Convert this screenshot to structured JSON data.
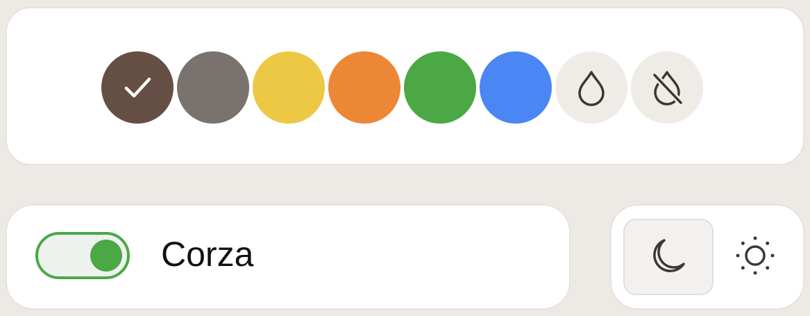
{
  "palette": {
    "swatches": [
      {
        "name": "brown",
        "color": "#654F45",
        "selected": true,
        "icon": "check-icon"
      },
      {
        "name": "gray",
        "color": "#7A726E",
        "selected": false
      },
      {
        "name": "yellow",
        "color": "#ECC844",
        "selected": false
      },
      {
        "name": "orange",
        "color": "#EC8735",
        "selected": false
      },
      {
        "name": "green",
        "color": "#4BA845",
        "selected": false
      },
      {
        "name": "blue",
        "color": "#4A87F4",
        "selected": false
      },
      {
        "name": "auto",
        "color": "#EFEBE6",
        "selected": false,
        "icon": "droplet-icon"
      },
      {
        "name": "none",
        "color": "#EFEBE6",
        "selected": false,
        "icon": "droplet-off-icon"
      }
    ]
  },
  "toggle": {
    "label": "Corza",
    "on": true,
    "accent": "#4BA845"
  },
  "theme": {
    "selected": "dark",
    "options": [
      {
        "name": "dark",
        "icon": "moon-icon"
      },
      {
        "name": "light",
        "icon": "sun-icon"
      }
    ]
  }
}
